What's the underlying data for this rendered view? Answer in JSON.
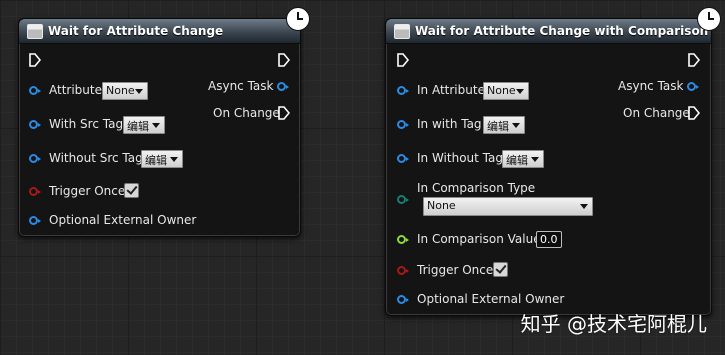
{
  "node1": {
    "title": "Wait for Attribute Change",
    "inputs": {
      "attribute": {
        "label": "Attribute",
        "value": "None"
      },
      "with_src_tag": {
        "label": "With Src Tag",
        "value": "编辑"
      },
      "without_src_tag": {
        "label": "Without Src Tag",
        "value": "编辑"
      },
      "trigger_once": {
        "label": "Trigger Once",
        "checked": true
      },
      "optional_owner": {
        "label": "Optional External Owner"
      }
    },
    "outputs": {
      "async_task": "Async Task",
      "on_change": "On Change"
    }
  },
  "node2": {
    "title": "Wait for Attribute Change with Comparison",
    "inputs": {
      "in_attribute": {
        "label": "In Attribute",
        "value": "None"
      },
      "in_with_tag": {
        "label": "In with Tag",
        "value": "编辑"
      },
      "in_without_tag": {
        "label": "In Without Tag",
        "value": "编辑"
      },
      "comparison_type": {
        "label": "In Comparison Type",
        "value": "None"
      },
      "comparison_value": {
        "label": "In Comparison Value",
        "value": "0.0"
      },
      "trigger_once": {
        "label": "Trigger Once",
        "checked": true
      },
      "optional_owner": {
        "label": "Optional External Owner"
      }
    },
    "outputs": {
      "async_task": "Async Task",
      "on_change": "On Change"
    }
  },
  "watermark": "知乎 @技术宅阿棍儿",
  "colors": {
    "object_pin": "#2a8be5",
    "bool_pin": "#a81919",
    "enum_pin": "#187e6f",
    "float_pin": "#8ed83b"
  }
}
